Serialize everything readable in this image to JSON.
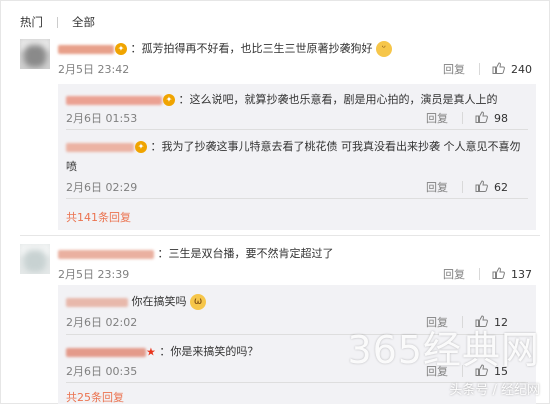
{
  "tabs": {
    "hot": "热门",
    "all": "全部"
  },
  "comments": [
    {
      "text": "：孤芳拍得再不好看，也比三生三世原著抄袭狗好",
      "time": "2月5日 23:42",
      "reply_label": "回复",
      "likes": "240",
      "replies": [
        {
          "text": "：这么说吧，就算抄袭也乐意看，剧是用心拍的，演员是真人上的",
          "time": "2月6日 01:53",
          "reply_label": "回复",
          "likes": "98"
        },
        {
          "text": "：我为了抄袭这事儿特意去看了桃花债 可我真没看出来抄袭 个人意见不喜勿",
          "text2": "喷",
          "time": "2月6日 02:29",
          "reply_label": "回复",
          "likes": "62"
        }
      ],
      "more_label": "共141条回复"
    },
    {
      "text": "：三生是双台播，要不然肯定超过了",
      "time": "2月5日 23:39",
      "reply_label": "回复",
      "likes": "137",
      "replies": [
        {
          "text": "你在搞笑吗",
          "time": "2月6日 02:02",
          "reply_label": "回复",
          "likes": "12"
        },
        {
          "text": "：你是来搞笑的吗？",
          "time": "2月6日 00:35",
          "reply_label": "回复",
          "likes": "15"
        }
      ],
      "more_label": "共25条回复"
    }
  ],
  "watermark": {
    "main": "365经典网",
    "sub": "头条号 / 经纪网"
  },
  "colors": {
    "link": "#eb7350",
    "panel": "#f2f2f5",
    "meta": "#808080"
  },
  "icons": {
    "thumb": "thumbs-up-icon"
  }
}
